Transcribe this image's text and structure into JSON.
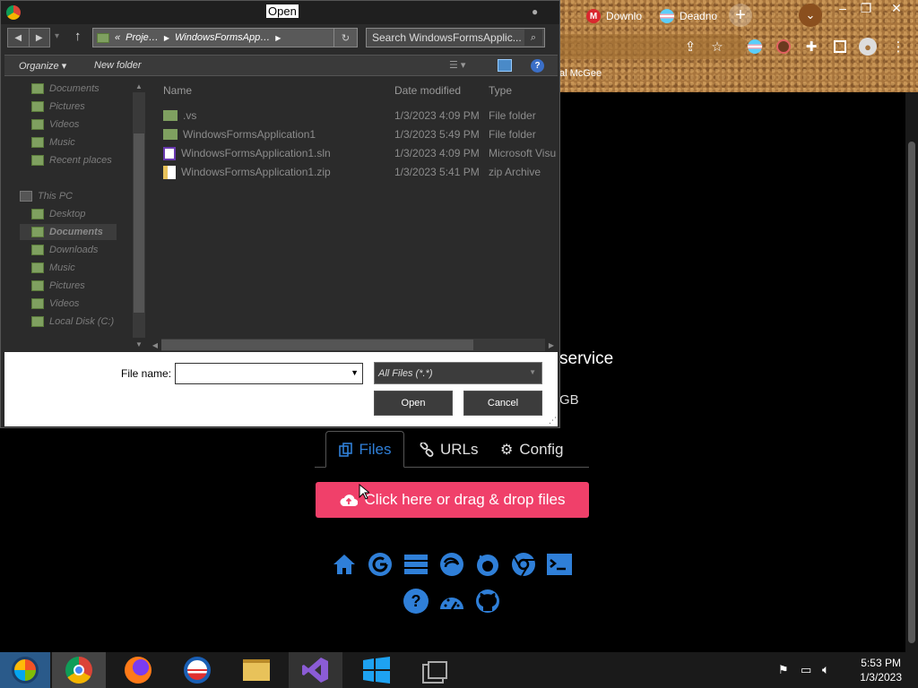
{
  "browser": {
    "tabs": [
      {
        "label": "Downlo",
        "icon": "mega-icon",
        "color": "#d9272e"
      },
      {
        "label": "Deadno",
        "icon": "trans-flag-icon",
        "color": "#f5a9b8"
      }
    ],
    "bookmark": "al McGee"
  },
  "page": {
    "service_text": "service",
    "size_text": "GB",
    "tabs": [
      {
        "label": "Files",
        "icon": "files-icon"
      },
      {
        "label": "URLs",
        "icon": "link-icon"
      },
      {
        "label": "Config",
        "icon": "gears-icon"
      }
    ],
    "upload_label": "Click here or drag & drop files",
    "accent": "#2f7fd8",
    "upload_color": "#f0406a"
  },
  "dialog": {
    "title": "Open",
    "breadcrumb": [
      "«",
      "Proje…",
      "WindowsFormsApp…"
    ],
    "search_placeholder": "Search WindowsFormsApplic...",
    "organize_label": "Organize",
    "new_folder_label": "New folder",
    "nav": [
      {
        "label": "Documents",
        "indent": 1
      },
      {
        "label": "Pictures",
        "indent": 1
      },
      {
        "label": "Videos",
        "indent": 1
      },
      {
        "label": "Music",
        "indent": 1
      },
      {
        "label": "Recent places",
        "indent": 1
      },
      {
        "label": "This PC",
        "indent": 0
      },
      {
        "label": "Desktop",
        "indent": 1
      },
      {
        "label": "Documents",
        "indent": 1
      },
      {
        "label": "Downloads",
        "indent": 1
      },
      {
        "label": "Music",
        "indent": 1
      },
      {
        "label": "Pictures",
        "indent": 1
      },
      {
        "label": "Videos",
        "indent": 1
      },
      {
        "label": "Local Disk (C:)",
        "indent": 1
      }
    ],
    "columns": [
      "Name",
      "Date modified",
      "Type"
    ],
    "files": [
      {
        "name": ".vs",
        "date": "1/3/2023 4:09 PM",
        "type": "File folder",
        "icon": "folder-icon"
      },
      {
        "name": "WindowsFormsApplication1",
        "date": "1/3/2023 5:49 PM",
        "type": "File folder",
        "icon": "folder-icon"
      },
      {
        "name": "WindowsFormsApplication1.sln",
        "date": "1/3/2023 4:09 PM",
        "type": "Microsoft Visu",
        "icon": "sln-file-icon"
      },
      {
        "name": "WindowsFormsApplication1.zip",
        "date": "1/3/2023 5:41 PM",
        "type": "zip Archive",
        "icon": "zip-file-icon"
      }
    ],
    "file_name_label": "File name:",
    "file_name_value": "",
    "file_type": "All Files (*.*)",
    "open_label": "Open",
    "cancel_label": "Cancel"
  },
  "taskbar": {
    "time": "5:53 PM",
    "date": "1/3/2023"
  }
}
